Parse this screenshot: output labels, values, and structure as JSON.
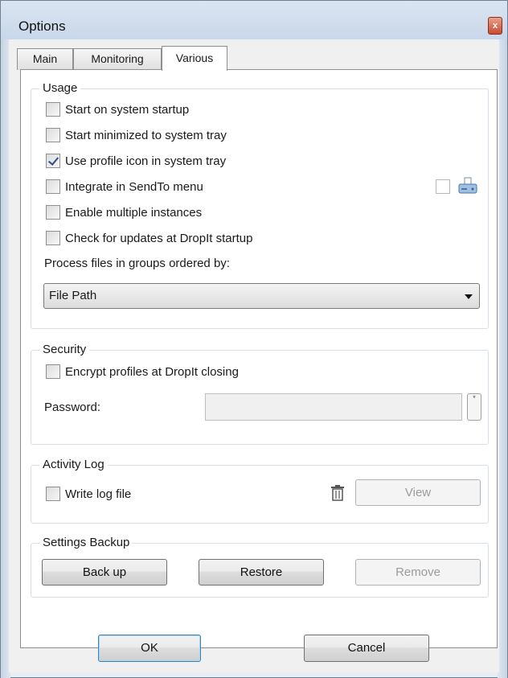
{
  "window": {
    "title": "Options",
    "close_label": "x"
  },
  "tabs": [
    {
      "label": "Main",
      "active": false
    },
    {
      "label": "Monitoring",
      "active": false
    },
    {
      "label": "Various",
      "active": true
    }
  ],
  "usage": {
    "title": "Usage",
    "options": [
      {
        "label": "Start on system startup",
        "checked": false
      },
      {
        "label": "Start minimized to system tray",
        "checked": false
      },
      {
        "label": "Use profile icon in system tray",
        "checked": true
      },
      {
        "label": "Integrate in SendTo menu",
        "checked": false
      },
      {
        "label": "Enable multiple instances",
        "checked": false
      },
      {
        "label": "Check for updates at DropIt startup",
        "checked": false
      }
    ],
    "sendto_extra_checked": false,
    "sendto_icon": "drive-icon",
    "process_label": "Process files in groups ordered by:",
    "process_value": "File Path"
  },
  "security": {
    "title": "Security",
    "encrypt_label": "Encrypt profiles at DropIt closing",
    "encrypt_checked": false,
    "password_label": "Password:",
    "password_value": "",
    "password_toggle": "*"
  },
  "activity_log": {
    "title": "Activity Log",
    "write_label": "Write log file",
    "write_checked": false,
    "delete_icon": "trash-icon",
    "view_label": "View"
  },
  "backup": {
    "title": "Settings Backup",
    "backup_label": "Back up",
    "restore_label": "Restore",
    "remove_label": "Remove"
  },
  "footer": {
    "ok_label": "OK",
    "cancel_label": "Cancel"
  },
  "colors": {
    "titlebar": "#c8d7ea",
    "frame": "#6f7f94",
    "default_button_border": "#3c7fb1",
    "check_mark": "#2a4f8a"
  }
}
